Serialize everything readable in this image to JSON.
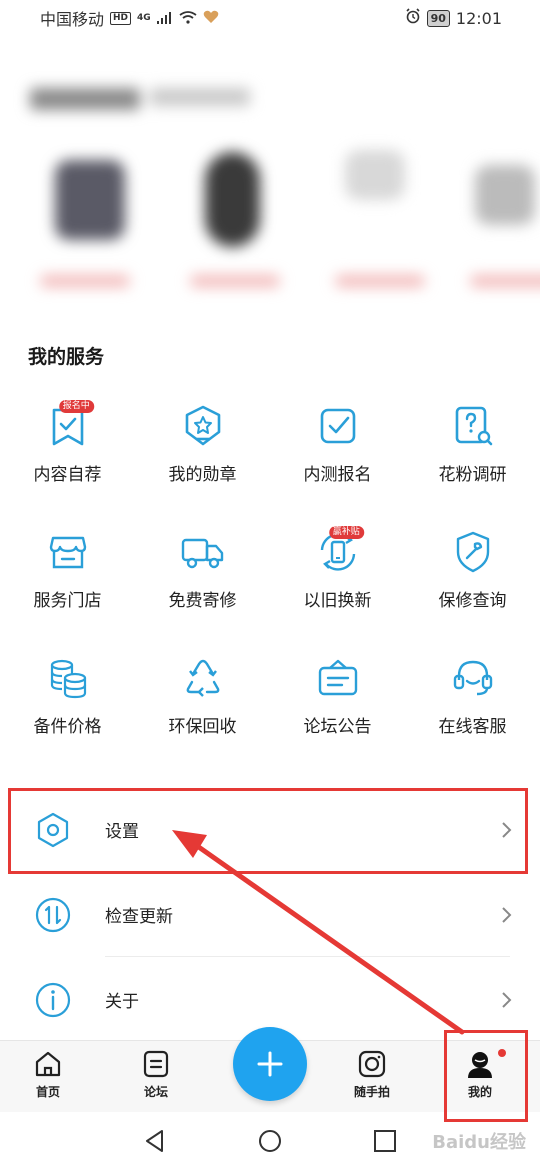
{
  "status_bar": {
    "carrier": "中国移动",
    "hd": "HD",
    "network": "4G",
    "battery": "90",
    "time": "12:01"
  },
  "services": {
    "title": "我的服务",
    "items": [
      {
        "label": "内容自荐",
        "icon": "checkmark-bookmark-icon",
        "badge": "报名中"
      },
      {
        "label": "我的勋章",
        "icon": "medal-icon"
      },
      {
        "label": "内测报名",
        "icon": "checkbox-icon"
      },
      {
        "label": "花粉调研",
        "icon": "survey-icon"
      },
      {
        "label": "服务门店",
        "icon": "store-icon"
      },
      {
        "label": "免费寄修",
        "icon": "truck-icon"
      },
      {
        "label": "以旧换新",
        "icon": "trade-in-icon",
        "badge": "赢补贴"
      },
      {
        "label": "保修查询",
        "icon": "warranty-shield-icon"
      },
      {
        "label": "备件价格",
        "icon": "coins-icon"
      },
      {
        "label": "环保回收",
        "icon": "recycle-icon"
      },
      {
        "label": "论坛公告",
        "icon": "notice-board-icon"
      },
      {
        "label": "在线客服",
        "icon": "headset-icon"
      }
    ]
  },
  "settings_list": [
    {
      "label": "设置",
      "icon": "hexagon-settings-icon"
    },
    {
      "label": "检查更新",
      "icon": "update-icon"
    },
    {
      "label": "关于",
      "icon": "info-icon"
    }
  ],
  "bottom_nav": {
    "home": "首页",
    "forum": "论坛",
    "snap": "随手拍",
    "me": "我的"
  },
  "watermark": "Baidu经验",
  "colors": {
    "accent": "#1fa3ef",
    "icon_blue": "#2a9fd8",
    "annotation_red": "#e53935",
    "badge_red": "#e03a3a"
  }
}
